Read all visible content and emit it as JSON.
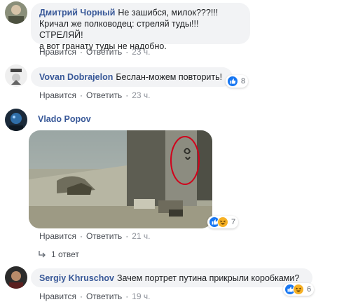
{
  "comments": [
    {
      "author": "Дмитрий Чорный",
      "text_line1": "Не зашибся, милок???!!!",
      "text_line2": "Кричал же полководец: стреляй туды!!! СТРЕЛЯЙ!",
      "text_line3": "а вот гранату туды не надобно.",
      "like_label": "Нравится",
      "reply_label": "Ответить",
      "time": "23 ч."
    },
    {
      "author": "Vovan Dobrajelon",
      "text": "Беслан-можем повторить!",
      "reactions_count": "8",
      "like_label": "Нравится",
      "reply_label": "Ответить",
      "time": "23 ч."
    },
    {
      "author": "Vlado Popov",
      "reactions_count": "7",
      "like_label": "Нравится",
      "reply_label": "Ответить",
      "time": "21 ч.",
      "replies_label": "1 ответ"
    },
    {
      "author": "Sergiy Khruschov",
      "text": "Зачем портрет путина прикрыли коробками?",
      "reactions_count": "6",
      "like_label": "Нравится",
      "reply_label": "Ответить",
      "time": "19 ч."
    }
  ],
  "icons": [
    "like-icon",
    "haha-icon",
    "reply-arrow-icon"
  ],
  "colors": {
    "author": "#385898",
    "bubble": "#f2f3f5",
    "like": "#1877f2",
    "highlight_circle": "#d0021b"
  }
}
